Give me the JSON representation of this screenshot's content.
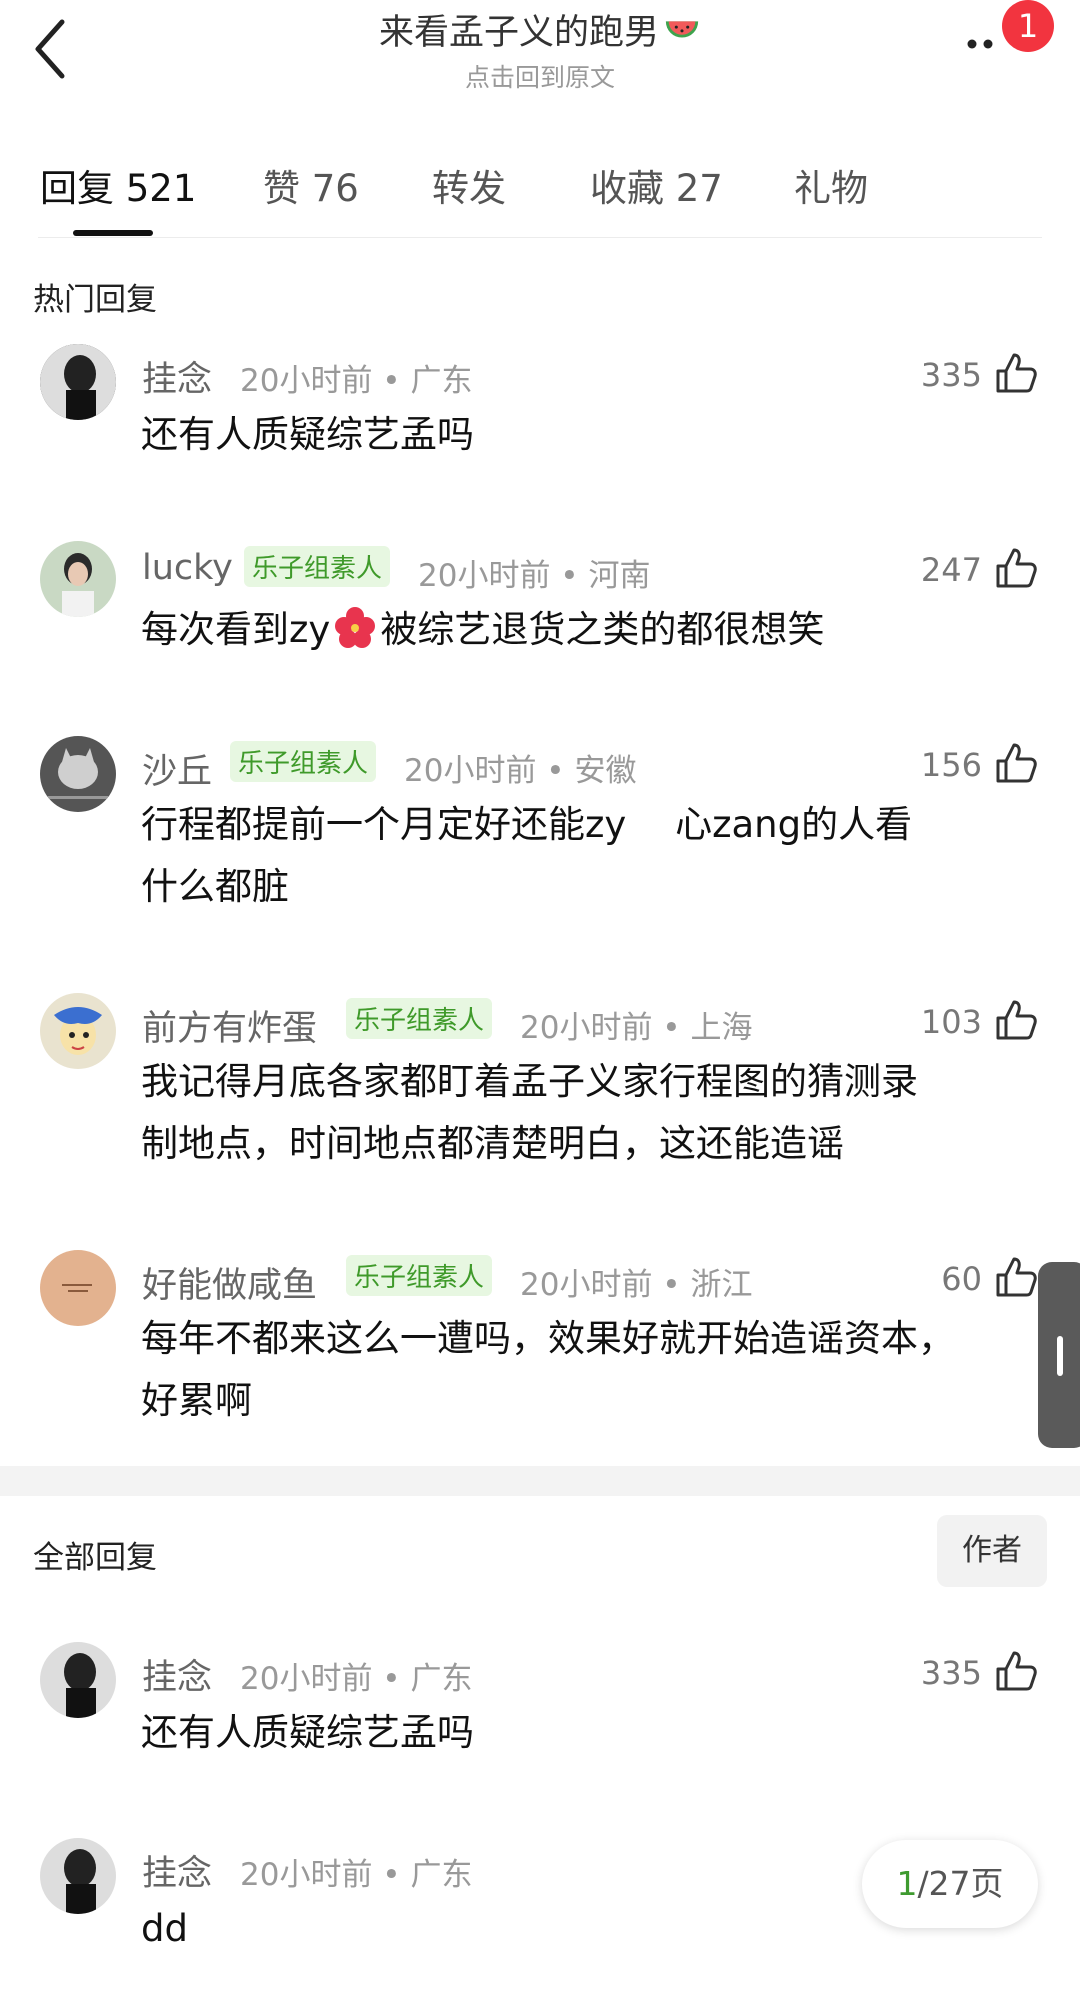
{
  "header": {
    "title": "来看孟子义的跑男",
    "subtitle": "点击回到原文",
    "badge_count": "1"
  },
  "tabs": [
    {
      "label": "回复 521"
    },
    {
      "label": "赞 76"
    },
    {
      "label": "转发"
    },
    {
      "label": "收藏 27"
    },
    {
      "label": "礼物"
    }
  ],
  "hot": {
    "section_title": "热门回复",
    "comments": [
      {
        "user": "挂念",
        "tag": "",
        "meta": "20小时前 • 广东",
        "likes": "335",
        "lines": [
          "还有人质疑综艺孟吗"
        ]
      },
      {
        "user": "lucky",
        "tag": "乐子组素人",
        "meta": "20小时前 • 河南",
        "likes": "247",
        "lines": [
          "每次看到zy",
          "被综艺退货之类的都很想笑"
        ]
      },
      {
        "user": "沙丘",
        "tag": "乐子组素人",
        "meta": "20小时前 • 安徽",
        "likes": "156",
        "lines": [
          "行程都提前一个月定好还能zy　 心zang的人看",
          "什么都脏"
        ]
      },
      {
        "user": "前方有炸蛋",
        "tag": "乐子组素人",
        "meta": "20小时前 • 上海",
        "likes": "103",
        "lines": [
          "我记得月底各家都盯着孟子义家行程图的猜测录",
          "制地点，时间地点都清楚明白，这还能造谣"
        ]
      },
      {
        "user": "好能做咸鱼",
        "tag": "乐子组素人",
        "meta": "20小时前 • 浙江",
        "likes": "60",
        "lines": [
          "每年不都来这么一遭吗，效果好就开始造谣资本，",
          "好累啊"
        ]
      }
    ]
  },
  "all": {
    "section_title": "全部回复",
    "author_button": "作者",
    "comments": [
      {
        "user": "挂念",
        "meta": "20小时前 • 广东",
        "likes": "335",
        "lines": [
          "还有人质疑综艺孟吗"
        ]
      },
      {
        "user": "挂念",
        "meta": "20小时前 • 广东",
        "likes": "",
        "lines": [
          "dd"
        ]
      }
    ]
  },
  "pager": {
    "current": "1",
    "rest": "/27页"
  }
}
